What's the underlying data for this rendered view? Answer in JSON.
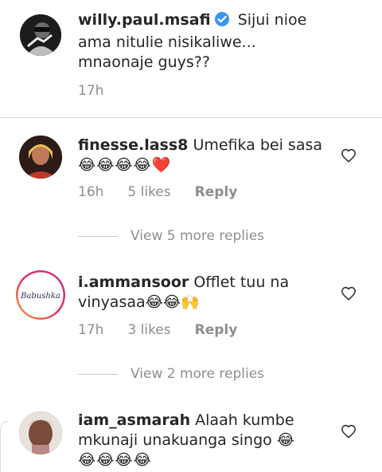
{
  "caption": {
    "username": "willy.paul.msafi",
    "text": "Sijui nioe ama nitulie nisikaliwe... mnaonaje guys??",
    "time": "17h"
  },
  "comments": [
    {
      "username": "finesse.lass8",
      "text": "Umefika bei sasa",
      "emojis": "😂😂😂😂❤️",
      "time": "16h",
      "likes": "5 likes",
      "reply": "Reply",
      "view_more": "View 5 more replies"
    },
    {
      "username": "i.ammansoor",
      "text": "Offlet tuu na vinyasaa😂😂🙌",
      "avatar_text": "Babushka",
      "time": "17h",
      "likes": "3 likes",
      "reply": "Reply",
      "view_more": "View 2 more replies"
    },
    {
      "username": "iam_asmarah",
      "text": "Alaah kumbe mkunaji unakuanga singo 😂",
      "emojis": "😂😂😂😂"
    }
  ],
  "colors": {
    "verified": "#3897f0",
    "muted": "#8e8e8e",
    "text": "#262626"
  }
}
